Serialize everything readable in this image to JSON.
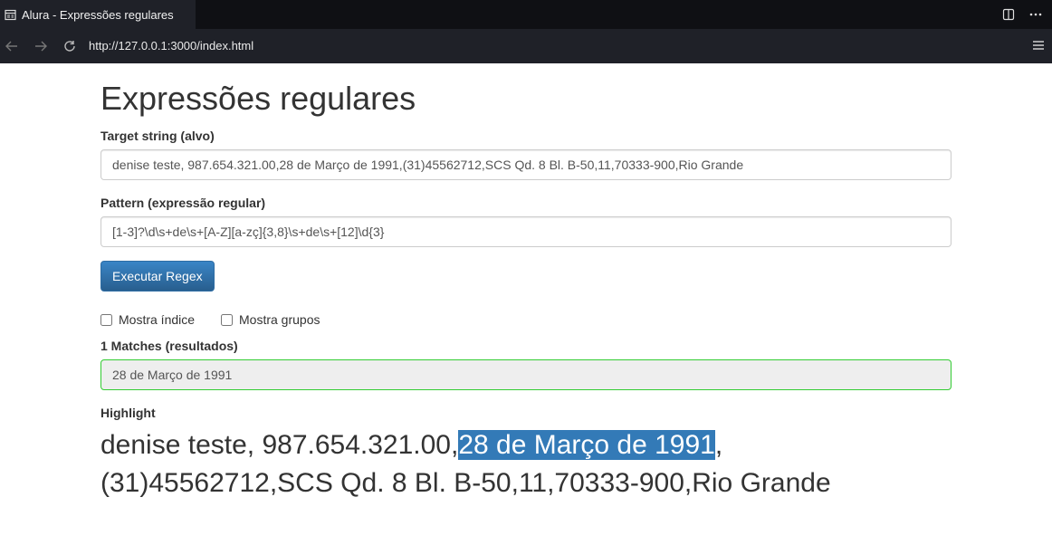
{
  "browser": {
    "tab_title": "Alura - Expressões regulares",
    "url": "http://127.0.0.1:3000/index.html"
  },
  "page": {
    "title": "Expressões regulares",
    "target_label": "Target string (alvo)",
    "target_value": "denise teste, 987.654.321.00,28 de Março de 1991,(31)45562712,SCS Qd. 8 Bl. B-50,11,70333-900,Rio Grande",
    "pattern_label": "Pattern (expressão regular)",
    "pattern_value": "[1-3]?\\d\\s+de\\s+[A-Z][a-zç]{3,8}\\s+de\\s+[12]\\d{3}",
    "execute_button": "Executar Regex",
    "show_index_label": "Mostra índice",
    "show_groups_label": "Mostra grupos",
    "matches_label": "1 Matches (resultados)",
    "matches_value": "28 de Março de 1991",
    "highlight_label": "Highlight",
    "highlight": {
      "before": "denise teste, 987.654.321.00,",
      "match": "28 de Março de 1991",
      "after": ", (31)45562712,SCS Qd. 8 Bl. B-50,11,70333-900,Rio Grande"
    }
  },
  "colors": {
    "highlight_bg": "#337ab7",
    "primary_button": "#337ab7",
    "match_border": "#33cc33"
  }
}
